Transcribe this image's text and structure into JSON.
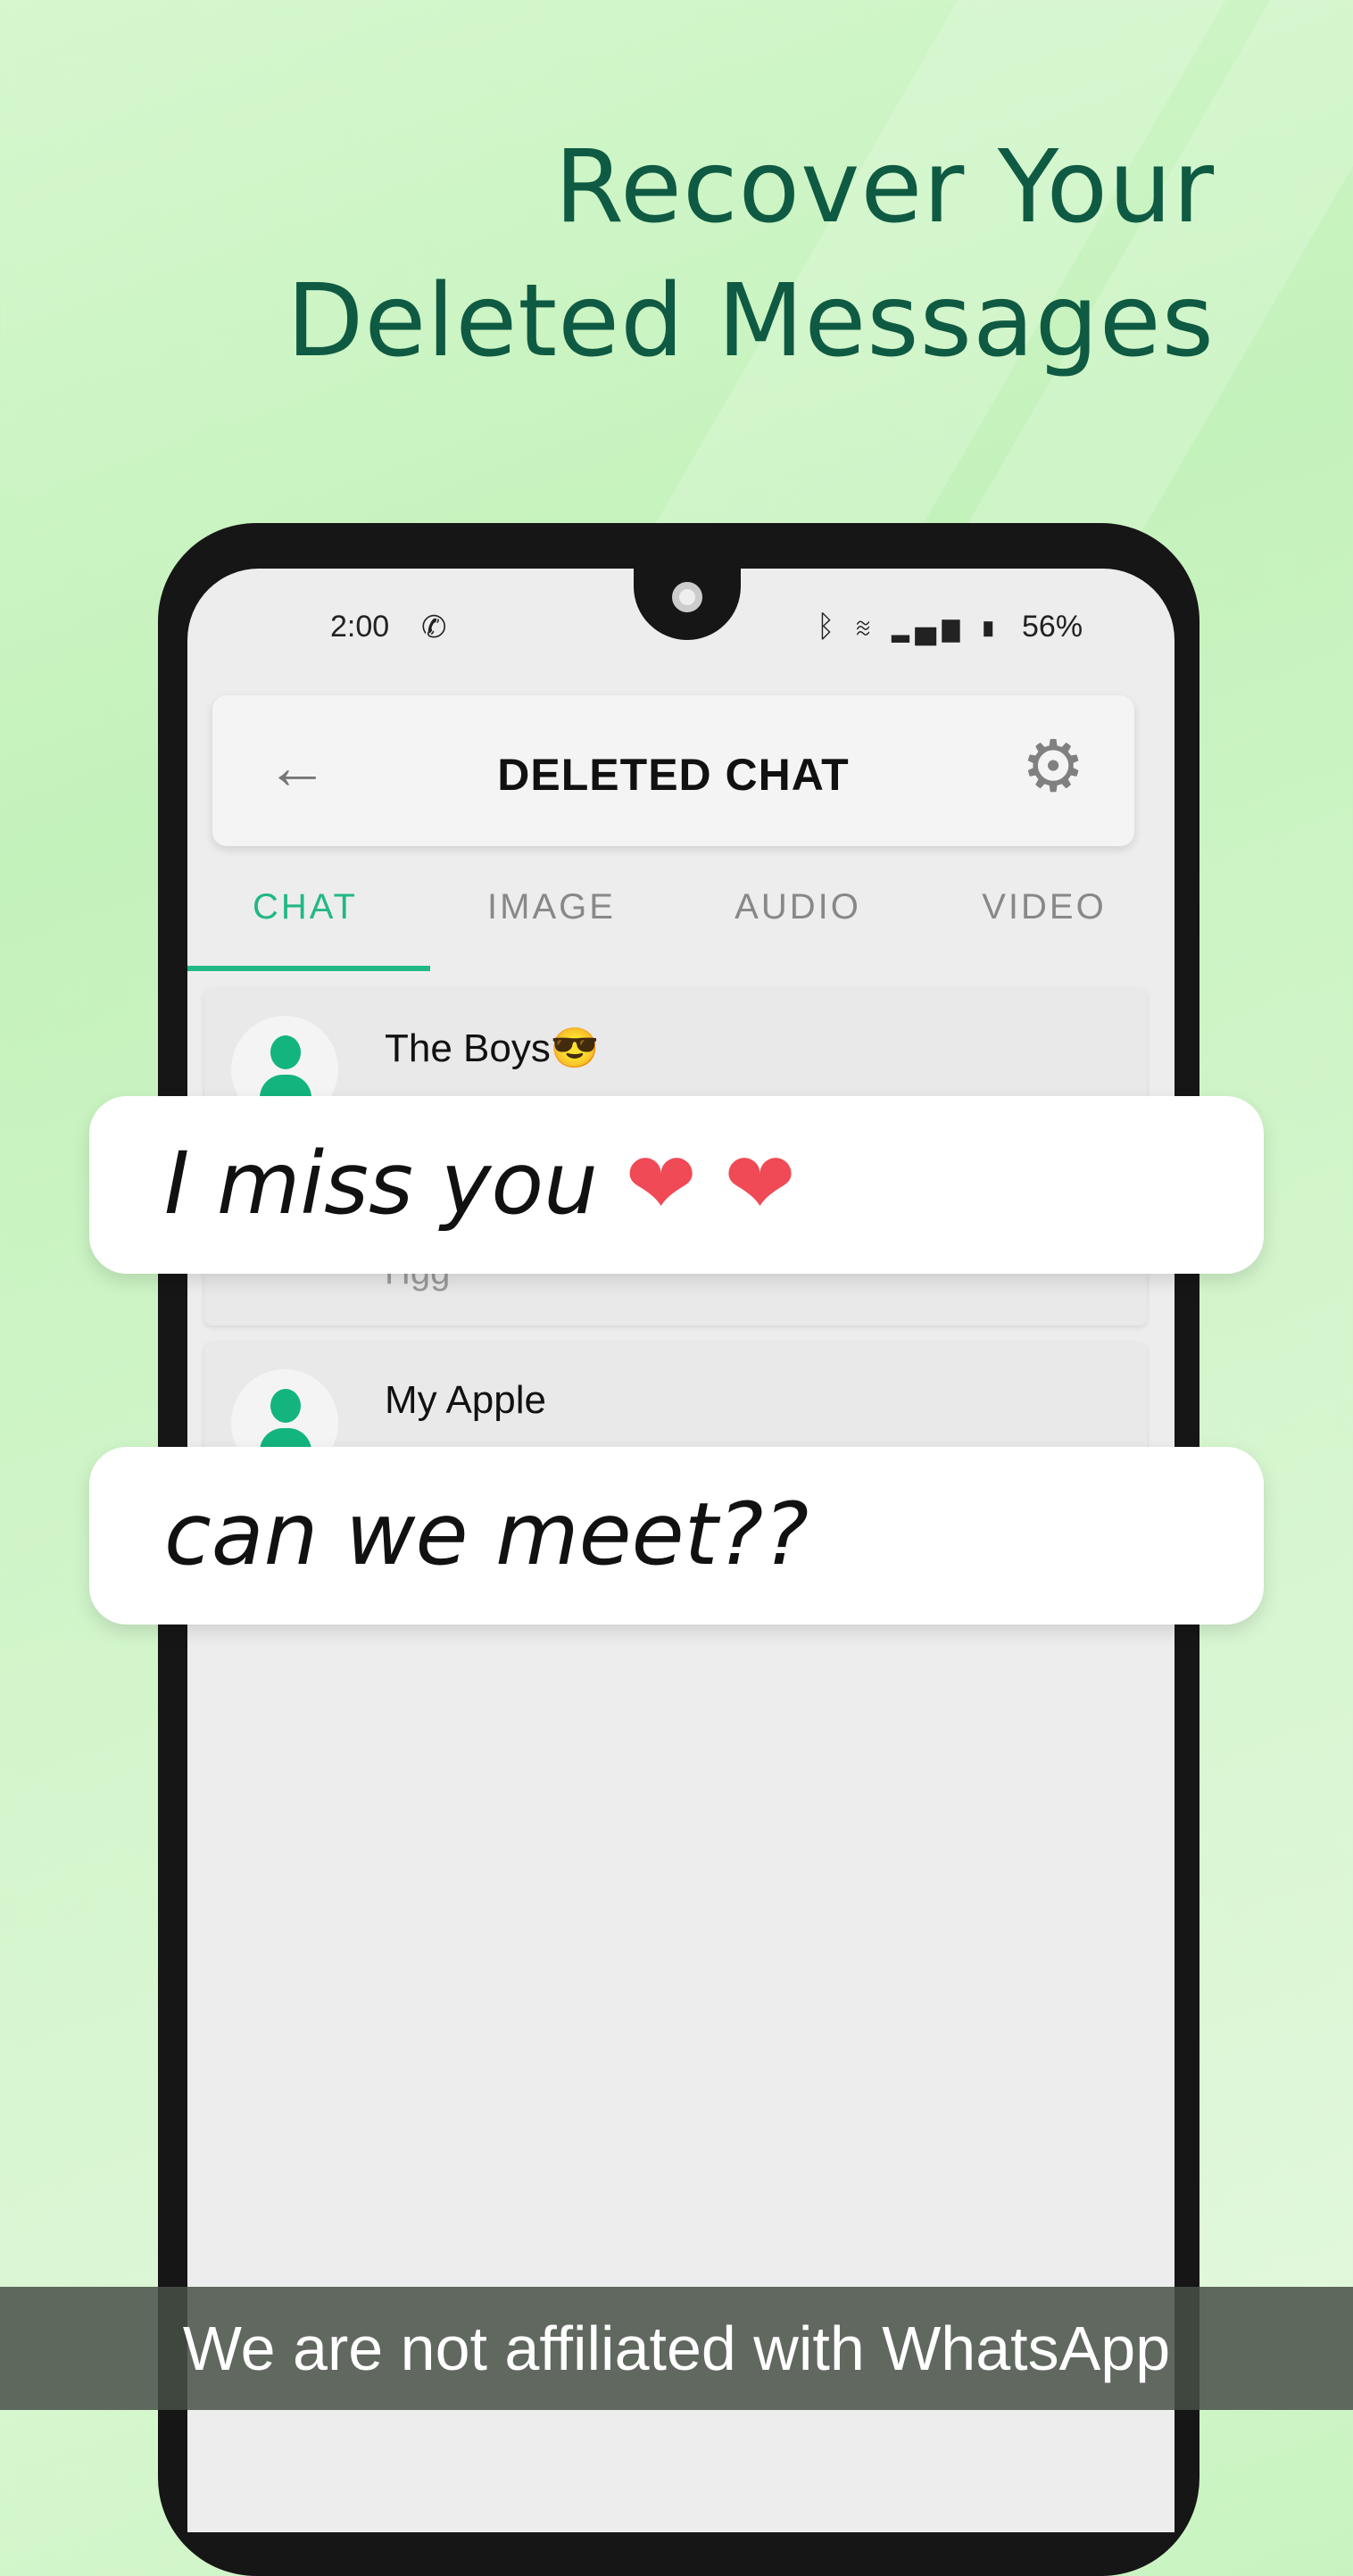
{
  "headline": {
    "line1": "Recover Your",
    "line2": "Deleted Messages"
  },
  "status_bar": {
    "time": "2:00",
    "battery": "56%",
    "icons": [
      "whatsapp-icon",
      "bluetooth-icon",
      "wifi-icon",
      "volte-icon",
      "signal-icon",
      "battery-icon"
    ]
  },
  "toolbar": {
    "title": "DELETED CHAT",
    "back_icon": "arrow-left-icon",
    "settings_icon": "gear-icon"
  },
  "tabs": [
    {
      "label": "CHAT",
      "active": true
    },
    {
      "label": "IMAGE"
    },
    {
      "label": "AUDIO"
    },
    {
      "label": "VIDEO"
    }
  ],
  "chats": [
    {
      "name": "The Boys😎",
      "preview": "Hgg"
    },
    {
      "name": "My Apple"
    }
  ],
  "bubbles": [
    {
      "text": "I miss you",
      "hearts": "❤ ❤"
    },
    {
      "text": "can we meet??"
    }
  ],
  "footer": "We are not affiliated with WhatsApp",
  "colors": {
    "accent": "#22b884",
    "headline": "#0f5a42",
    "heart": "#ef4a55"
  }
}
